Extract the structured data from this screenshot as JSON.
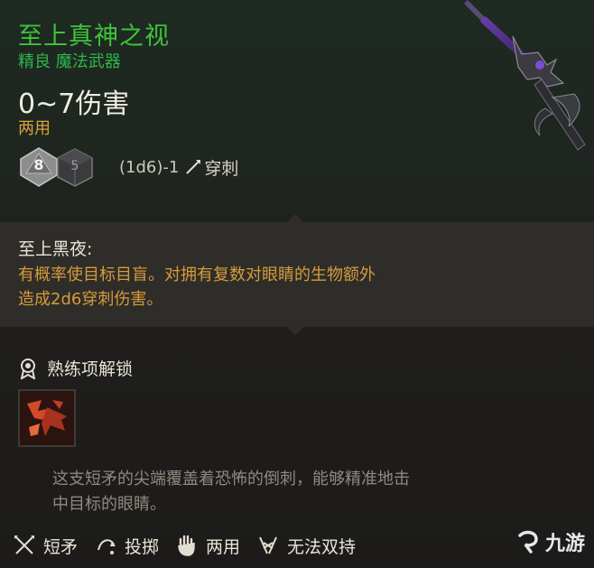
{
  "item": {
    "title": "至上真神之视",
    "rarity_type": "精良 魔法武器",
    "damage": "0~7伤害",
    "handedness": "两用",
    "dice": {
      "die1_value": "8",
      "die2_value": "5",
      "formula": "(1d6)-1",
      "damage_type": "穿刺"
    }
  },
  "passive": {
    "name": "至上黑夜:",
    "description_line1": "有概率使目标目盲。对拥有复数对眼睛的生物额外",
    "description_line2": "造成2d6穿刺伤害。"
  },
  "proficiency": {
    "header": "熟练项解锁"
  },
  "flavor": {
    "line1": "这支短矛的尖端覆盖着恐怖的倒刺，能够精准地击",
    "line2": "中目标的眼睛。"
  },
  "traits": [
    {
      "label": "短矛",
      "icon": "short-spear-icon"
    },
    {
      "label": "投掷",
      "icon": "throw-icon"
    },
    {
      "label": "两用",
      "icon": "versatile-hand-icon"
    },
    {
      "label": "无法双持",
      "icon": "no-dual-wield-icon"
    }
  ],
  "watermark": {
    "text": "九游",
    "icon": "jiuyou-logo-icon"
  },
  "colors": {
    "title": "#3fc23a",
    "rarity": "#2fb64a",
    "handed": "#d8a23c",
    "passive_desc": "#d59b3b",
    "flavor": "#8f8a80"
  }
}
